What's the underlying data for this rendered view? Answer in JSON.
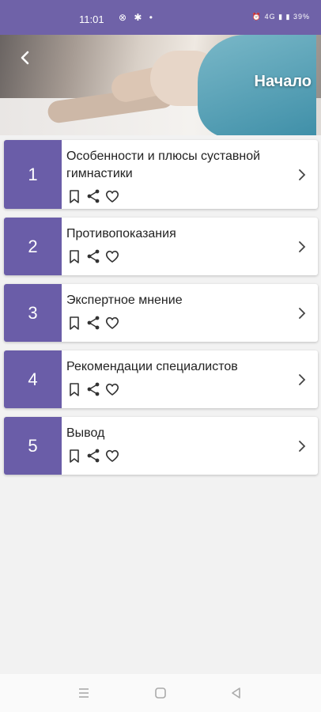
{
  "status_bar": {
    "time": "11:01",
    "left_icons": [
      "sync-icon",
      "gear-icon",
      "dot-icon"
    ],
    "right_text": "⏰ 4G ▮ ▮ 39%"
  },
  "header": {
    "title": "Начало",
    "back_icon": "chevron-left-icon"
  },
  "items": [
    {
      "number": "1",
      "title": "Особенности и плюсы суставной гимнастики"
    },
    {
      "number": "2",
      "title": "Противопоказания"
    },
    {
      "number": "3",
      "title": "Экспертное мнение"
    },
    {
      "number": "4",
      "title": "Рекомендации специалистов"
    },
    {
      "number": "5",
      "title": "Вывод"
    }
  ],
  "item_action_icons": [
    "bookmark-icon",
    "share-icon",
    "heart-icon"
  ],
  "colors": {
    "accent": "#6a5da8",
    "status_bar": "#6f62a8",
    "background": "#f2f2f2"
  },
  "navbar": {
    "icons": [
      "menu-icon",
      "home-icon",
      "back-triangle-icon"
    ]
  }
}
